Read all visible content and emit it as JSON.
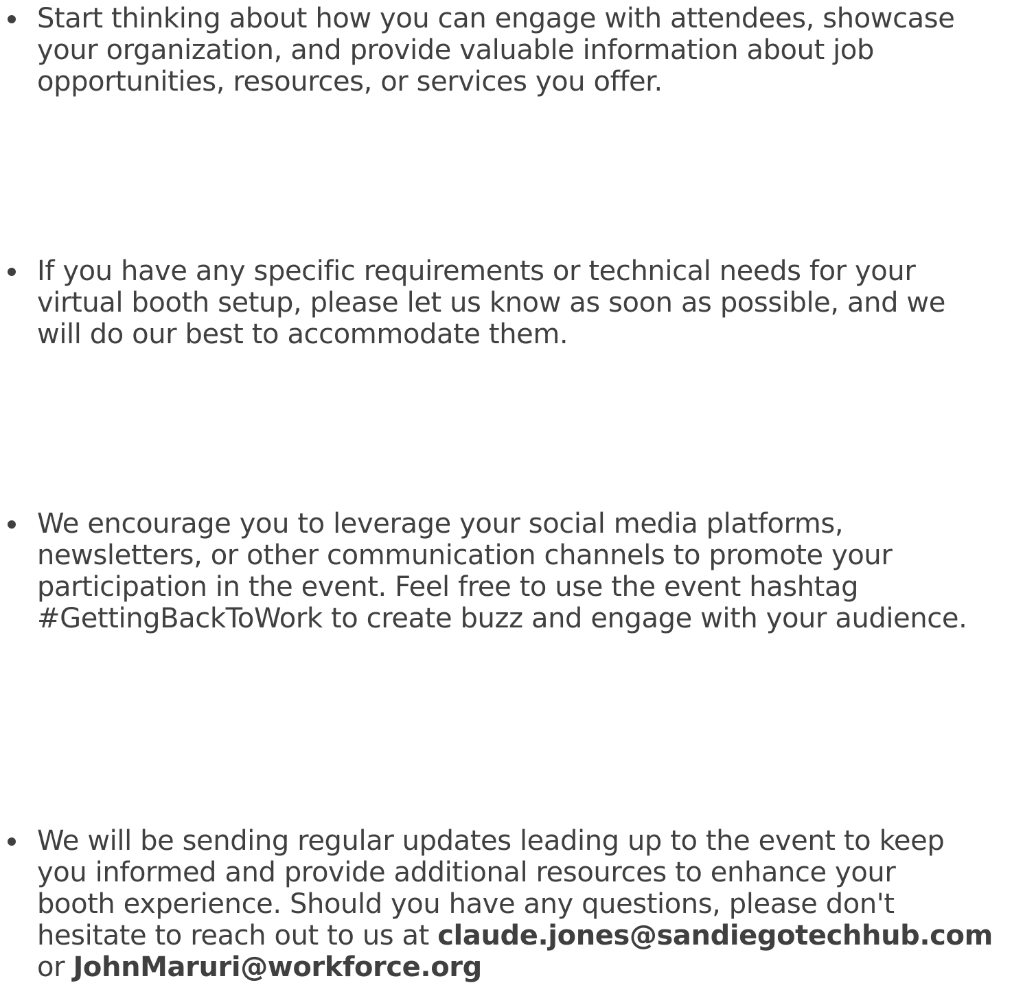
{
  "bullets": [
    {
      "lines": [
        "Start thinking about how you can engage with attendees, showcase",
        "your organization, and provide valuable information about job",
        "opportunities, resources, or services you offer."
      ]
    },
    {
      "lines": [
        "If you have any specific requirements or technical needs for your",
        "virtual booth setup, please let us know as soon as possible, and we",
        "will do our best to accommodate them."
      ]
    },
    {
      "lines": [
        "We encourage you to leverage your social media platforms,",
        "newsletters, or other communication channels to promote your",
        "participation in the event. Feel free to use the event hashtag",
        "#GettingBackToWork to create buzz and engage with your audience."
      ]
    },
    {
      "lines": [
        "We will be sending regular updates leading up to the event to keep",
        "you informed and provide additional resources to enhance your",
        "booth experience. Should you have any questions, please don't",
        "hesitate to reach out to us at "
      ],
      "email_primary": "claude.jones@sandiegotechhub.com",
      "or_text": "or ",
      "email_secondary": "JohnMaruri@workforce.org"
    }
  ],
  "colors": {
    "text": "#404040",
    "background": "#ffffff"
  }
}
